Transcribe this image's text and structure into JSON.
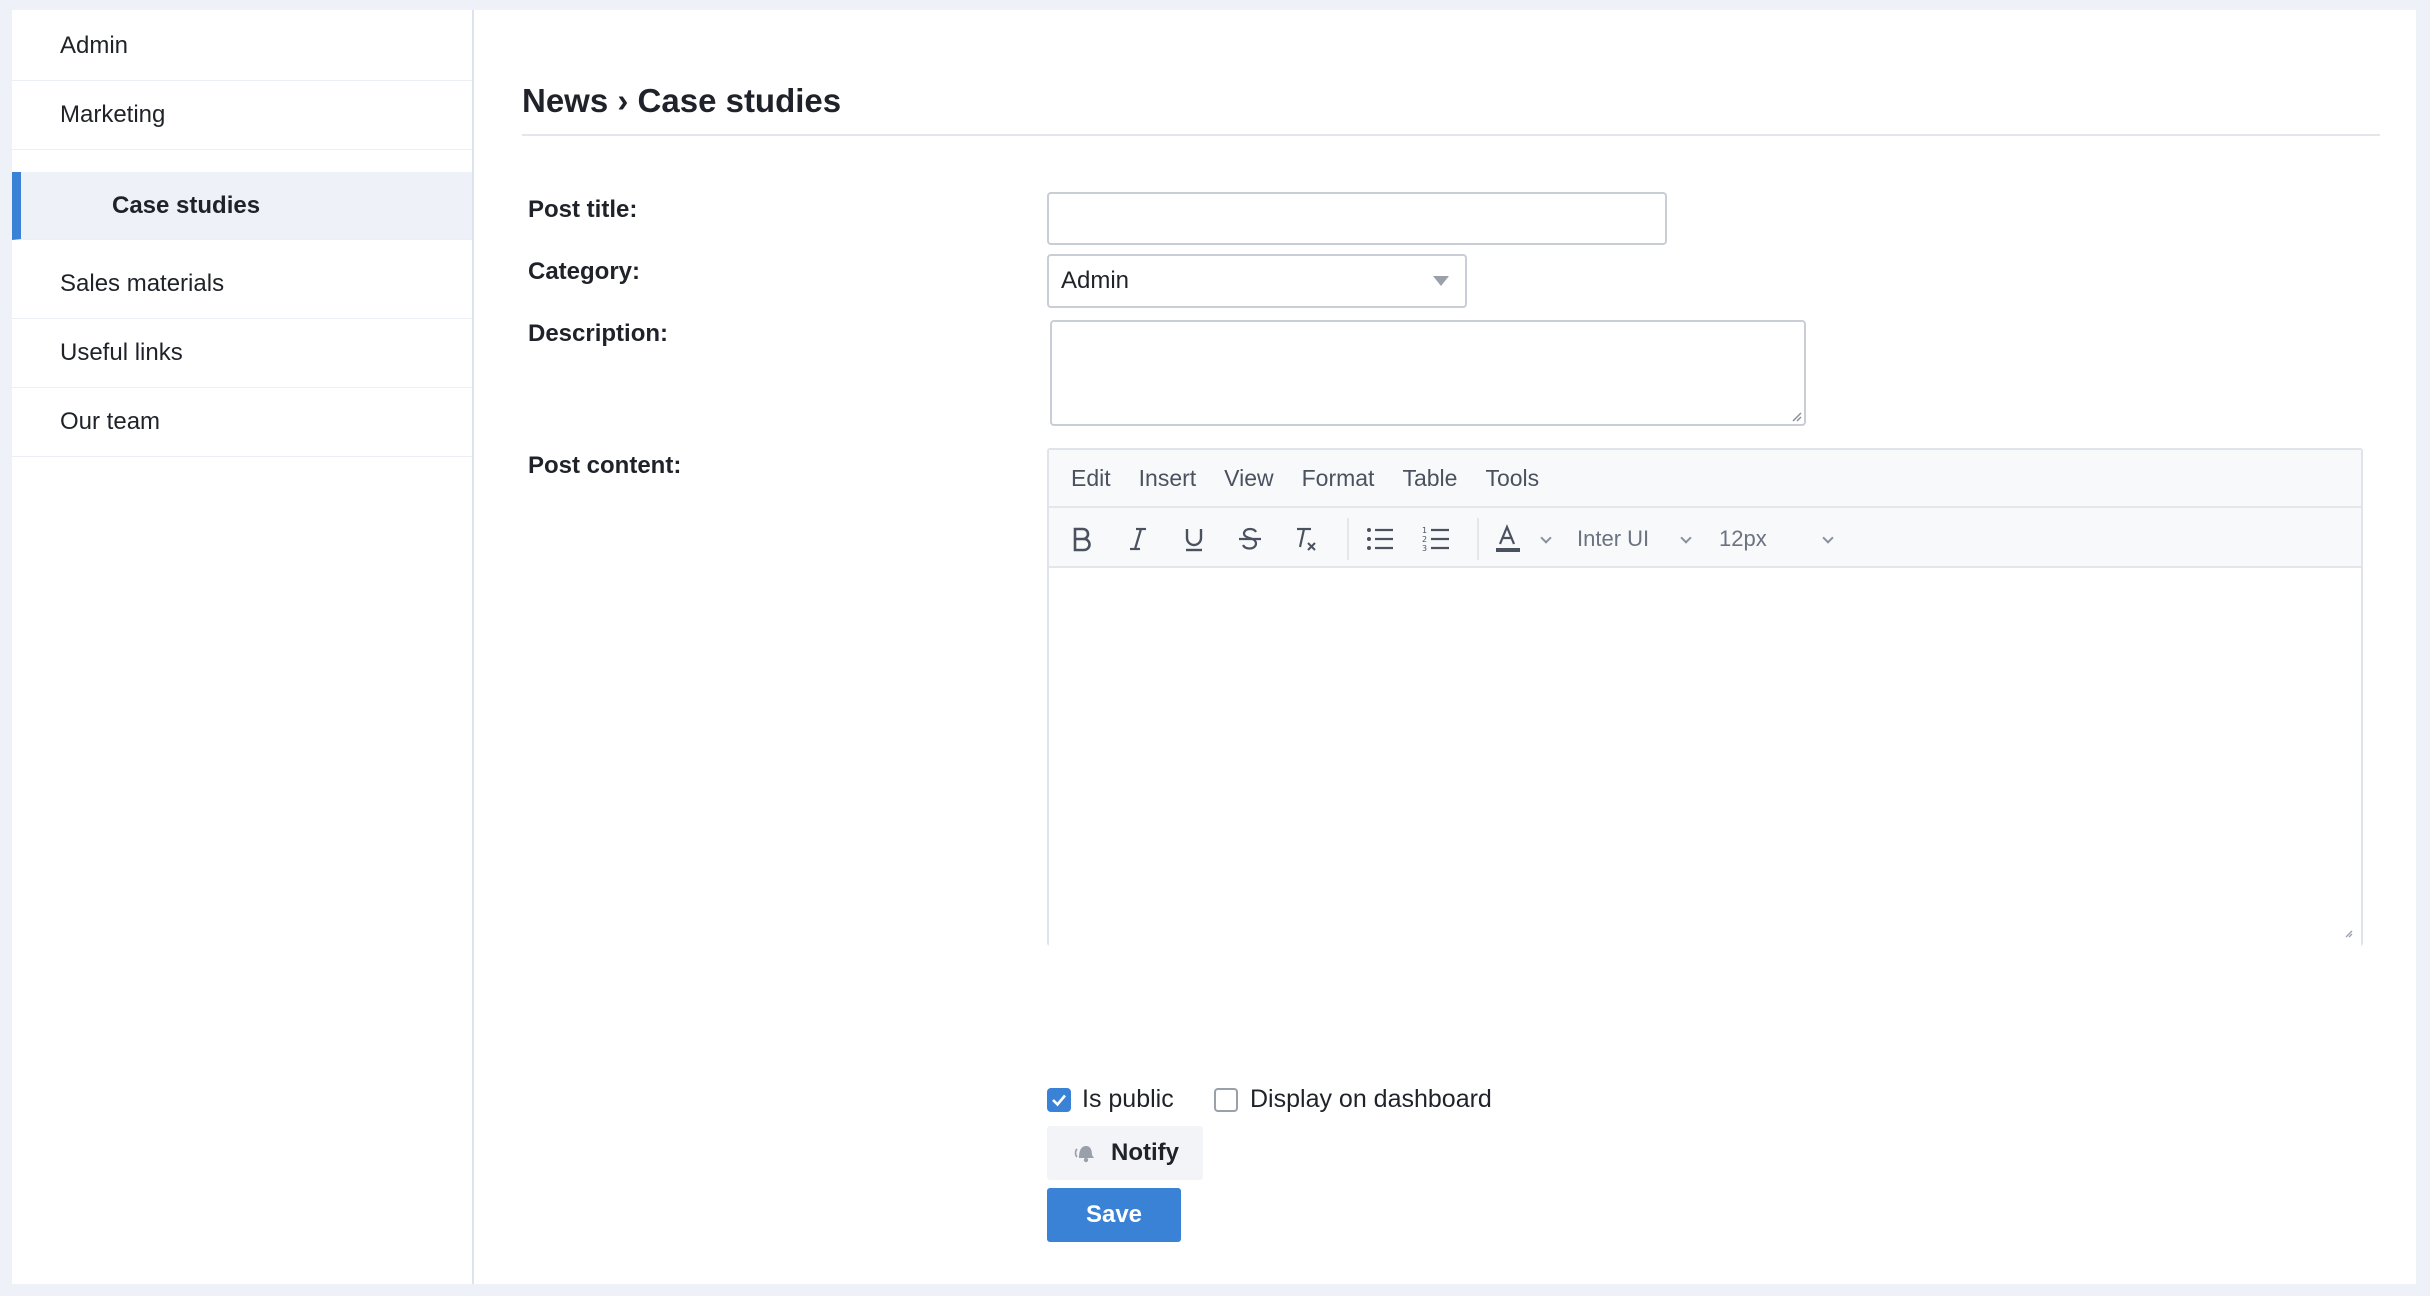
{
  "sidebar": {
    "items": [
      {
        "label": "Admin"
      },
      {
        "label": "Marketing"
      },
      {
        "label": "Case studies"
      },
      {
        "label": "Sales materials"
      },
      {
        "label": "Useful links"
      },
      {
        "label": "Our team"
      }
    ]
  },
  "header": {
    "breadcrumb": "News › Case studies"
  },
  "form": {
    "post_title_label": "Post title:",
    "post_title_value": "",
    "category_label": "Category:",
    "category_value": "Admin",
    "description_label": "Description:",
    "description_value": "",
    "post_content_label": "Post content:"
  },
  "editor": {
    "menu": [
      "Edit",
      "Insert",
      "View",
      "Format",
      "Table",
      "Tools"
    ],
    "font_family": "Inter UI",
    "font_size": "12px"
  },
  "options": {
    "is_public_label": "Is public",
    "is_public_checked": true,
    "dashboard_label": "Display on dashboard",
    "dashboard_checked": false
  },
  "actions": {
    "notify_label": "Notify",
    "save_label": "Save"
  },
  "colors": {
    "accent": "#3a82d6",
    "background": "#eef1f8"
  }
}
